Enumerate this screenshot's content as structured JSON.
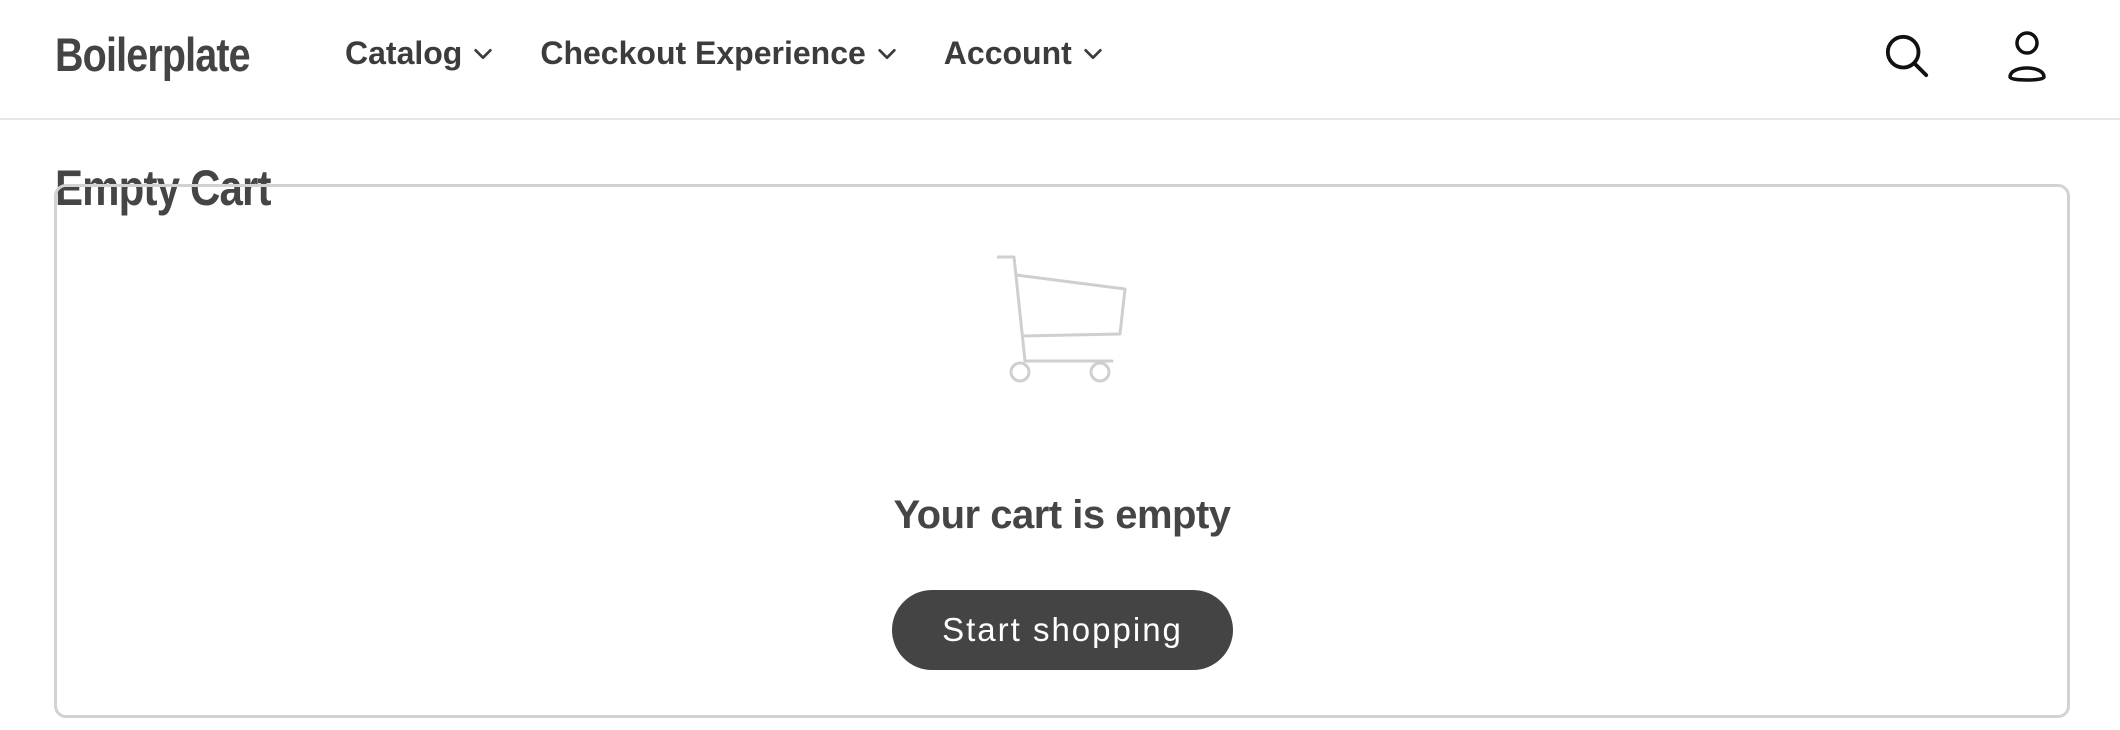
{
  "header": {
    "brand": "Boilerplate",
    "nav": [
      {
        "label": "Catalog",
        "icon": "chevron-down-icon"
      },
      {
        "label": "Checkout Experience",
        "icon": "chevron-down-icon"
      },
      {
        "label": "Account",
        "icon": "chevron-down-icon"
      }
    ],
    "actions": [
      {
        "icon": "search-icon"
      },
      {
        "icon": "user-icon"
      }
    ]
  },
  "page": {
    "title": "Empty Cart"
  },
  "cart": {
    "illustration_icon": "shopping-cart-icon",
    "empty_message": "Your cart is empty",
    "start_shopping_label": "Start shopping"
  },
  "colors": {
    "text": "#444444",
    "button": "#444444",
    "button_text": "#ffffff",
    "divider": "#e6e6e6",
    "panel_border": "#d2d2d2",
    "illustration": "#cfcfcf"
  }
}
